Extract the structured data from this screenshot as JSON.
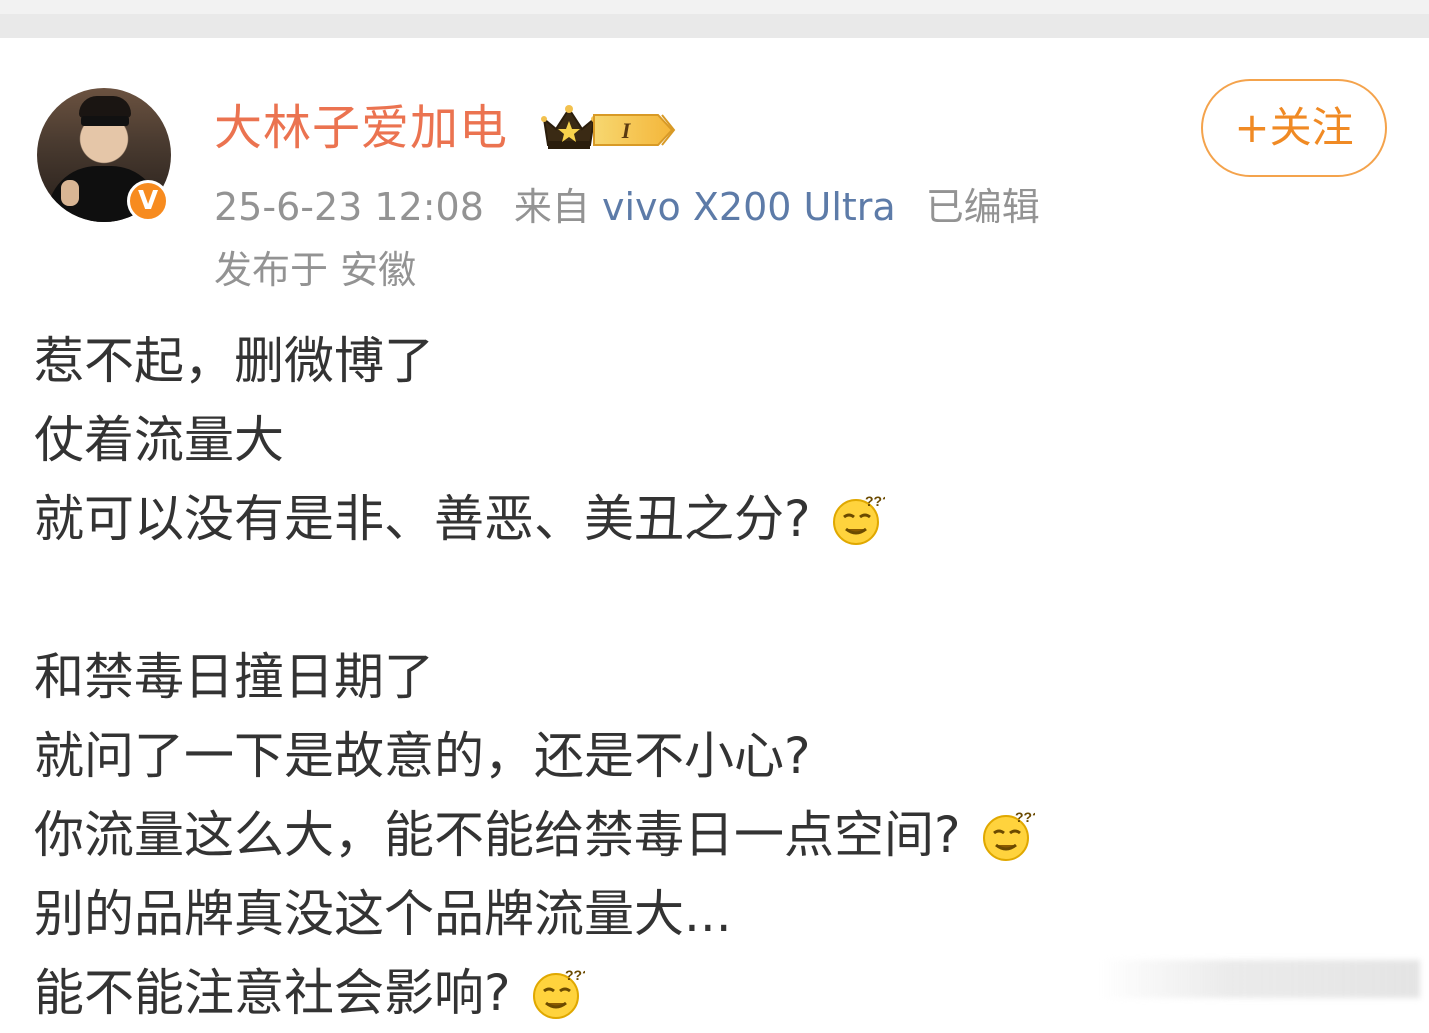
{
  "post": {
    "author": {
      "name": "大林子爱加电",
      "verified_icon": "verified-v-icon",
      "vip_icon": "crown-vip-level-icon",
      "vip_level_label": "I"
    },
    "follow_label": "+关注",
    "timestamp": "25-6-23 12:08",
    "source_prefix": "来自",
    "device": "vivo X200 Ultra",
    "edited_label": "已编辑",
    "location_label": "发布于 安徽",
    "content_lines": [
      "惹不起，删微博了",
      "仗着流量大",
      "就可以没有是非、善恶、美丑之分?",
      "",
      "和禁毒日撞日期了",
      "就问了一下是故意的，还是不小心?",
      "你流量这么大，能不能给禁毒日一点空间?",
      "别的品牌真没这个品牌流量大...",
      "能不能注意社会影响?"
    ],
    "emoji_name": "thinking-emoji-icon"
  },
  "colors": {
    "username": "#eb7350",
    "follow_border": "#f4a34c",
    "follow_text": "#f08a24",
    "device_link": "#5d7ba8",
    "meta_gray": "#939393",
    "body_text": "#333333",
    "verified_orange": "#f78b1f"
  }
}
